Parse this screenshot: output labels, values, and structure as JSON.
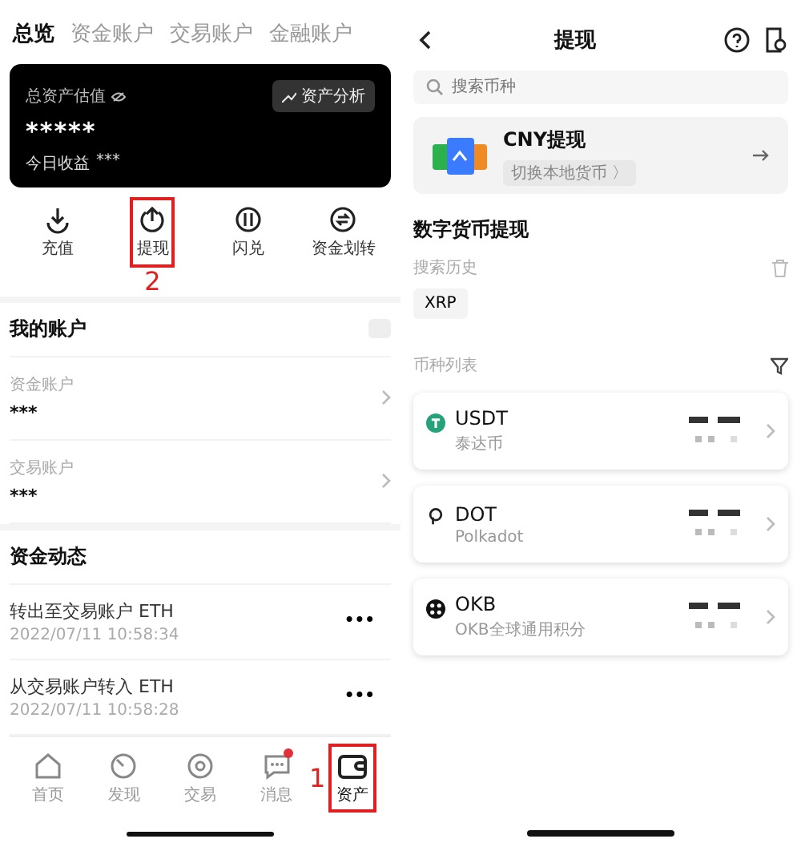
{
  "left": {
    "tabs": [
      {
        "label": "总览",
        "selected": true
      },
      {
        "label": "资金账户",
        "selected": false
      },
      {
        "label": "交易账户",
        "selected": false
      },
      {
        "label": "金融账户",
        "selected": false
      }
    ],
    "asset_card": {
      "label": "总资产估值",
      "value": "*****",
      "analysis_button": "资产分析",
      "today_label": "今日收益",
      "today_value": "***"
    },
    "actions": [
      {
        "kind": "deposit",
        "label": "充值",
        "highlighted": false
      },
      {
        "kind": "withdraw",
        "label": "提现",
        "highlighted": true,
        "callout": "2"
      },
      {
        "kind": "swap",
        "label": "闪兑",
        "highlighted": false
      },
      {
        "kind": "transfer",
        "label": "资金划转",
        "highlighted": false
      }
    ],
    "my_accounts": {
      "title": "我的账户",
      "items": [
        {
          "name": "资金账户",
          "value": "***"
        },
        {
          "name": "交易账户",
          "value": "***"
        }
      ]
    },
    "activity": {
      "title": "资金动态",
      "items": [
        {
          "title": "转出至交易账户 ETH",
          "time": "2022/07/11 10:58:34",
          "more": "•••"
        },
        {
          "title": "从交易账户转入 ETH",
          "time": "2022/07/11 10:58:28",
          "more": "•••"
        }
      ]
    },
    "nav": [
      {
        "kind": "home",
        "label": "首页",
        "selected": false,
        "badge": false,
        "highlighted": false
      },
      {
        "kind": "discover",
        "label": "发现",
        "selected": false,
        "badge": false,
        "highlighted": false
      },
      {
        "kind": "trade",
        "label": "交易",
        "selected": false,
        "badge": false,
        "highlighted": false
      },
      {
        "kind": "message",
        "label": "消息",
        "selected": false,
        "badge": true,
        "highlighted": false
      },
      {
        "kind": "wallet",
        "label": "资产",
        "selected": true,
        "badge": false,
        "highlighted": true,
        "callout": "1"
      }
    ]
  },
  "right": {
    "title": "提现",
    "search": {
      "placeholder": "搜索币种"
    },
    "cny": {
      "title": "CNY提现",
      "switch_label": "切换本地货币 〉"
    },
    "crypto_title": "数字货币提现",
    "history_label": "搜索历史",
    "history": [
      "XRP"
    ],
    "list_label": "币种列表",
    "coins": [
      {
        "kind": "tether",
        "symbol": "USDT",
        "name": "泰达币"
      },
      {
        "kind": "polkadot",
        "symbol": "DOT",
        "name": "Polkadot"
      },
      {
        "kind": "okb",
        "symbol": "OKB",
        "name": "OKB全球通用积分"
      }
    ]
  }
}
